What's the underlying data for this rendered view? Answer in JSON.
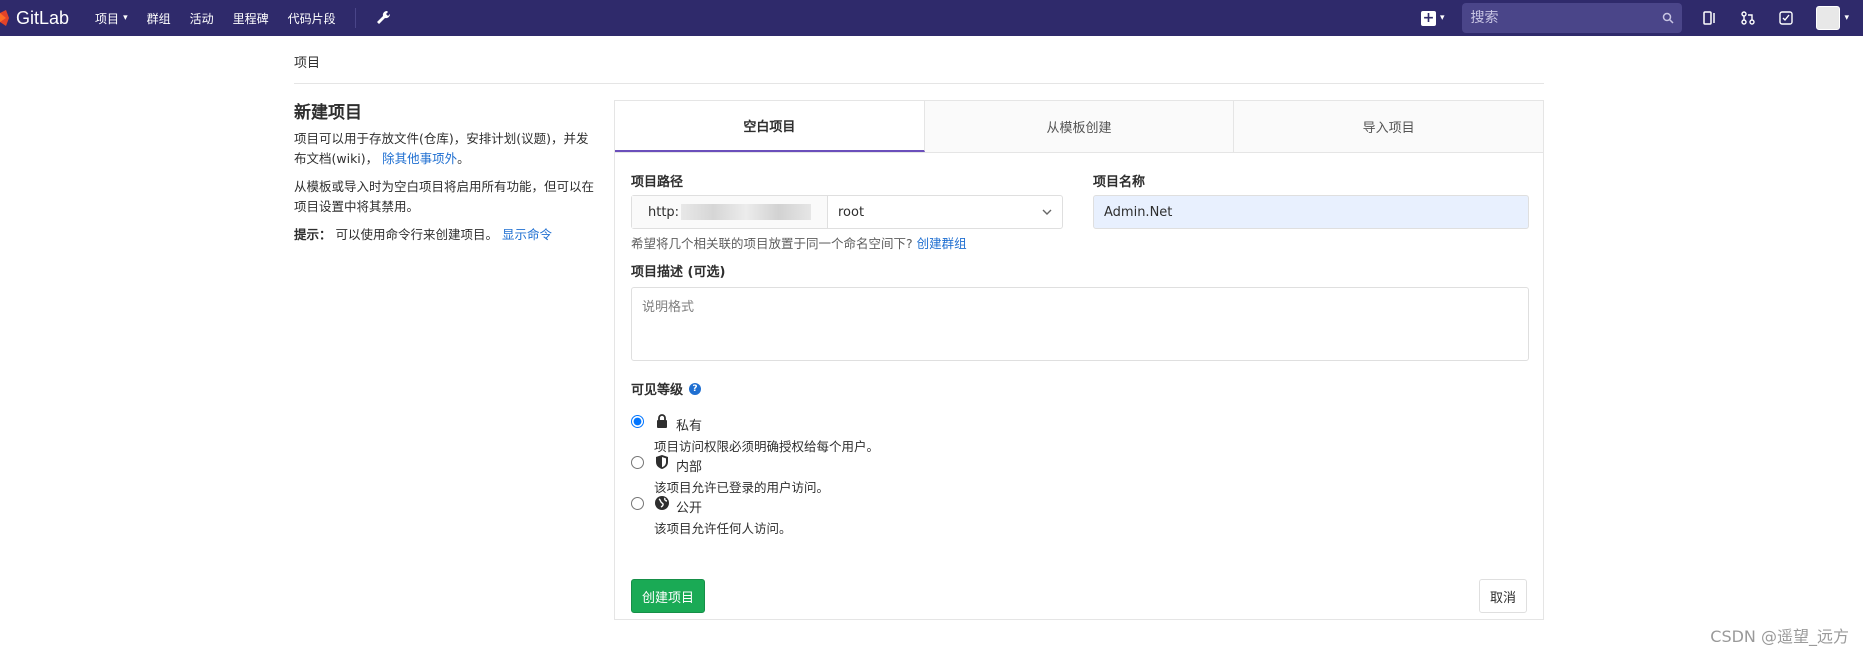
{
  "nav": {
    "brand": "GitLab",
    "items": [
      {
        "label": "项目",
        "dropdown": true
      },
      {
        "label": "群组"
      },
      {
        "label": "活动"
      },
      {
        "label": "里程碑"
      },
      {
        "label": "代码片段"
      }
    ],
    "search_placeholder": "搜索"
  },
  "breadcrumb": "项目",
  "left": {
    "title": "新建项目",
    "para1_text": "项目可以用于存放文件(仓库)，安排计划(议题)，并发布文档(wiki)，",
    "para1_link": "除其他事项外",
    "para1_end": "。",
    "para2": "从模板或导入时为空白项目将启用所有功能，但可以在项目设置中将其禁用。",
    "tip_label": "提示：",
    "tip_text": "可以使用命令行来创建项目。",
    "tip_link": "显示命令"
  },
  "tabs": [
    {
      "label": "空白项目",
      "active": true
    },
    {
      "label": "从模板创建",
      "active": false
    },
    {
      "label": "导入项目",
      "active": false
    }
  ],
  "form": {
    "path_label": "项目路径",
    "path_prefix": "http:",
    "namespace": "root",
    "name_label": "项目名称",
    "name_value": "Admin.Net",
    "hint_text": "希望将几个相关联的项目放置于同一个命名空间下?",
    "hint_link": "创建群组",
    "desc_label": "项目描述 (可选)",
    "desc_placeholder": "说明格式",
    "visibility_label": "可见等级",
    "visibility": [
      {
        "title": "私有",
        "desc": "项目访问权限必须明确授权给每个用户。",
        "checked": true,
        "icon": "lock-icon"
      },
      {
        "title": "内部",
        "desc": "该项目允许已登录的用户访问。",
        "checked": false,
        "icon": "shield-icon"
      },
      {
        "title": "公开",
        "desc": "该项目允许任何人访问。",
        "checked": false,
        "icon": "globe-icon"
      }
    ],
    "create_label": "创建项目",
    "cancel_label": "取消"
  },
  "watermark": "CSDN @遥望_远方"
}
